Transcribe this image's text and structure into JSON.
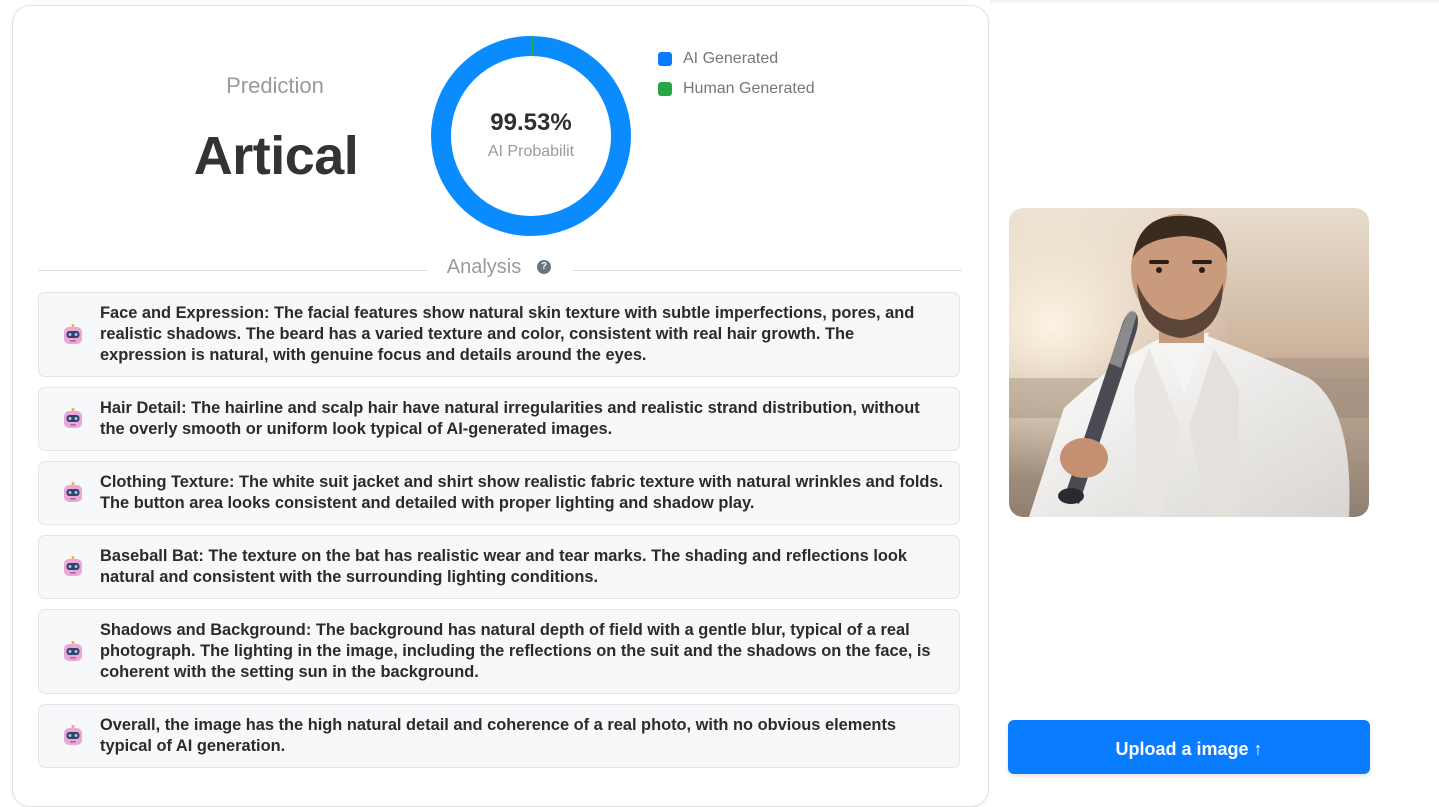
{
  "prediction": {
    "label": "Prediction",
    "value": "Artical"
  },
  "donut": {
    "percent_text": "99.53%",
    "subtitle": "AI Probabilit",
    "ai_fraction": 0.9953,
    "ai_color": "#0a8cff",
    "human_color": "#28a745"
  },
  "legend": [
    {
      "label": "AI Generated",
      "color": "#0a7cff"
    },
    {
      "label": "Human Generated",
      "color": "#28a745"
    }
  ],
  "analysis": {
    "title": "Analysis",
    "help_icon": "question-circle-icon",
    "help_glyph": "?",
    "items": [
      {
        "icon": "robot-icon",
        "text": "Face and Expression: The facial features show natural skin texture with subtle imperfections, pores, and realistic shadows. The beard has a varied texture and color, consistent with real hair growth. The expression is natural, with genuine focus and details around the eyes."
      },
      {
        "icon": "robot-icon",
        "text": "Hair Detail: The hairline and scalp hair have natural irregularities and realistic strand distribution, without the overly smooth or uniform look typical of AI-generated images."
      },
      {
        "icon": "robot-icon",
        "text": "Clothing Texture: The white suit jacket and shirt show realistic fabric texture with natural wrinkles and folds. The button area looks consistent and detailed with proper lighting and shadow play."
      },
      {
        "icon": "robot-icon",
        "text": "Baseball Bat: The texture on the bat has realistic wear and tear marks. The shading and reflections look natural and consistent with the surrounding lighting conditions."
      },
      {
        "icon": "robot-icon",
        "text": "Shadows and Background: The background has natural depth of field with a gentle blur, typical of a real photograph. The lighting in the image, including the reflections on the suit and the shadows on the face, is coherent with the setting sun in the background."
      },
      {
        "icon": "robot-icon",
        "text": "Overall, the image has the high natural detail and coherence of a real photo, with no obvious elements typical of AI generation."
      }
    ]
  },
  "upload": {
    "label": "Upload a image ↑",
    "color": "#0a7cff"
  }
}
